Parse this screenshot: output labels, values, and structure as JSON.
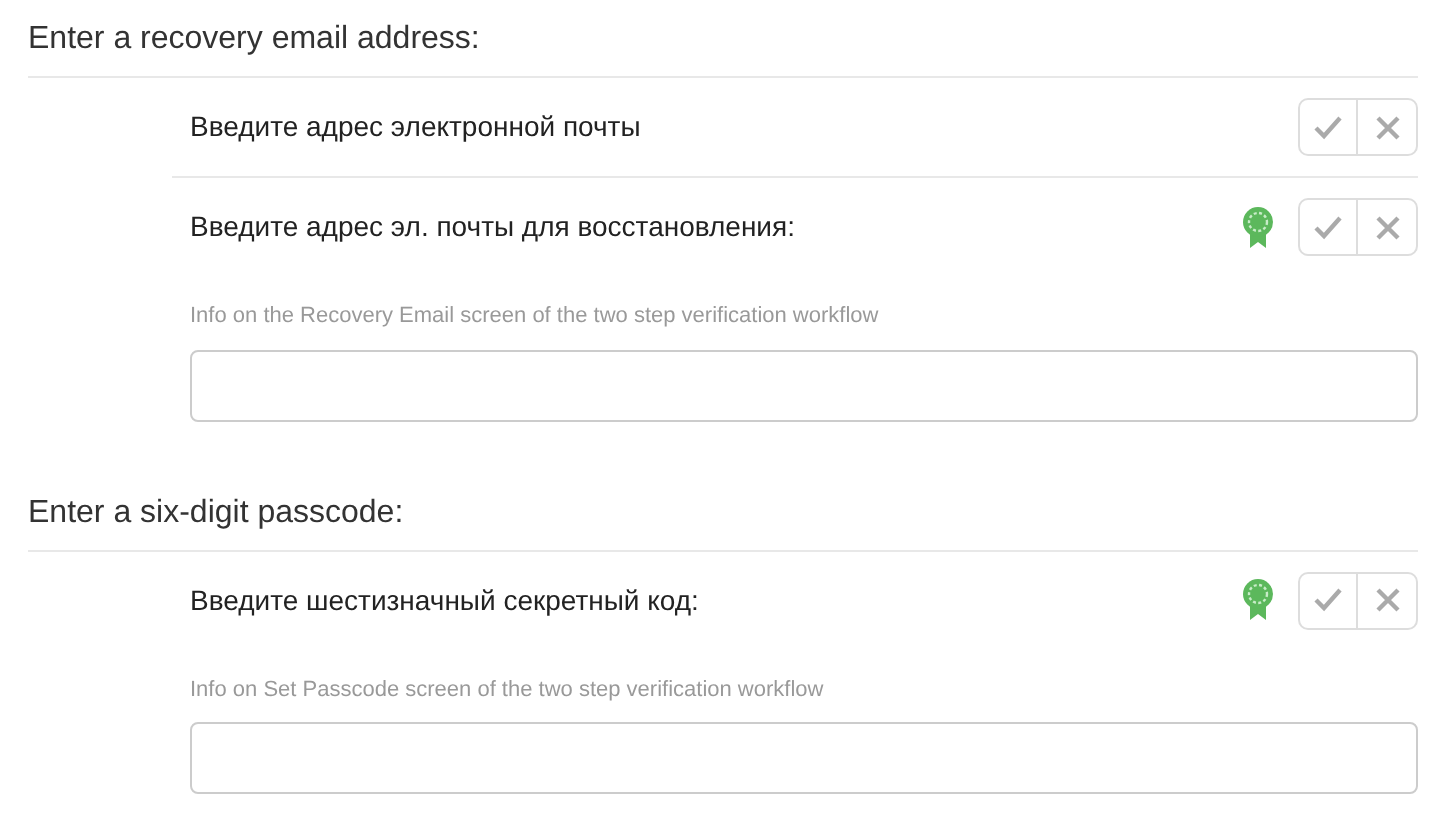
{
  "sections": [
    {
      "title": "Enter a recovery email address:",
      "translations": [
        {
          "text": "Введите адрес электронной почты",
          "approved": false
        },
        {
          "text": "Введите адрес эл. почты для восстановления:",
          "approved": true,
          "info": "Info on the Recovery Email screen of the two step verification workflow"
        }
      ]
    },
    {
      "title": "Enter a six-digit passcode:",
      "translations": [
        {
          "text": "Введите шестизначный секретный код:",
          "approved": true,
          "info": "Info on Set Passcode screen of the two step verification workflow"
        }
      ]
    }
  ]
}
